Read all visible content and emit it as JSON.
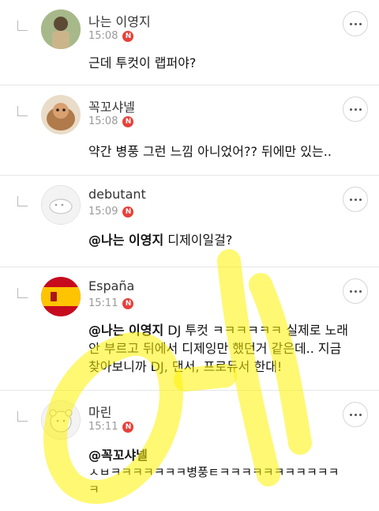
{
  "comments": [
    {
      "name": "나는 이영지",
      "time": "15:08",
      "badge": "N",
      "text": "근데 투컷이 랩퍼야?"
    },
    {
      "name": "꼭꼬샤넬",
      "time": "15:08",
      "badge": "N",
      "text": "약간 병풍 그런 느낌 아니었어?? 뒤에만 있는.."
    },
    {
      "name": "debutant",
      "time": "15:09",
      "badge": "N",
      "mention": "@나는 이영지",
      "text": " 디제이일걸?"
    },
    {
      "name": "España",
      "time": "15:11",
      "badge": "N",
      "mention": "@나는 이영지",
      "text": " DJ 투컷 ㅋㅋㅋㅋㅋㅋ 실제로 노래",
      "line2": "안 부르고 뒤에서 디제잉만 했던거 같은데.. 지금",
      "line3": "찾아보니까 DJ, 댄서, 프로듀서 한대!"
    },
    {
      "name": "마린",
      "time": "15:11",
      "badge": "N",
      "mention": "@꼭꼬샤넬",
      "text": "ㅅㅂㅋㅋㅋㅋㅋㅋㅋ병풍ㅌㅋㅋㅋㅋㅋㅋㅋㅋㅋㅋㅋ",
      "line2": "ㅋ"
    }
  ],
  "watermark": {
    "text": "여시",
    "color": "#fff200"
  }
}
